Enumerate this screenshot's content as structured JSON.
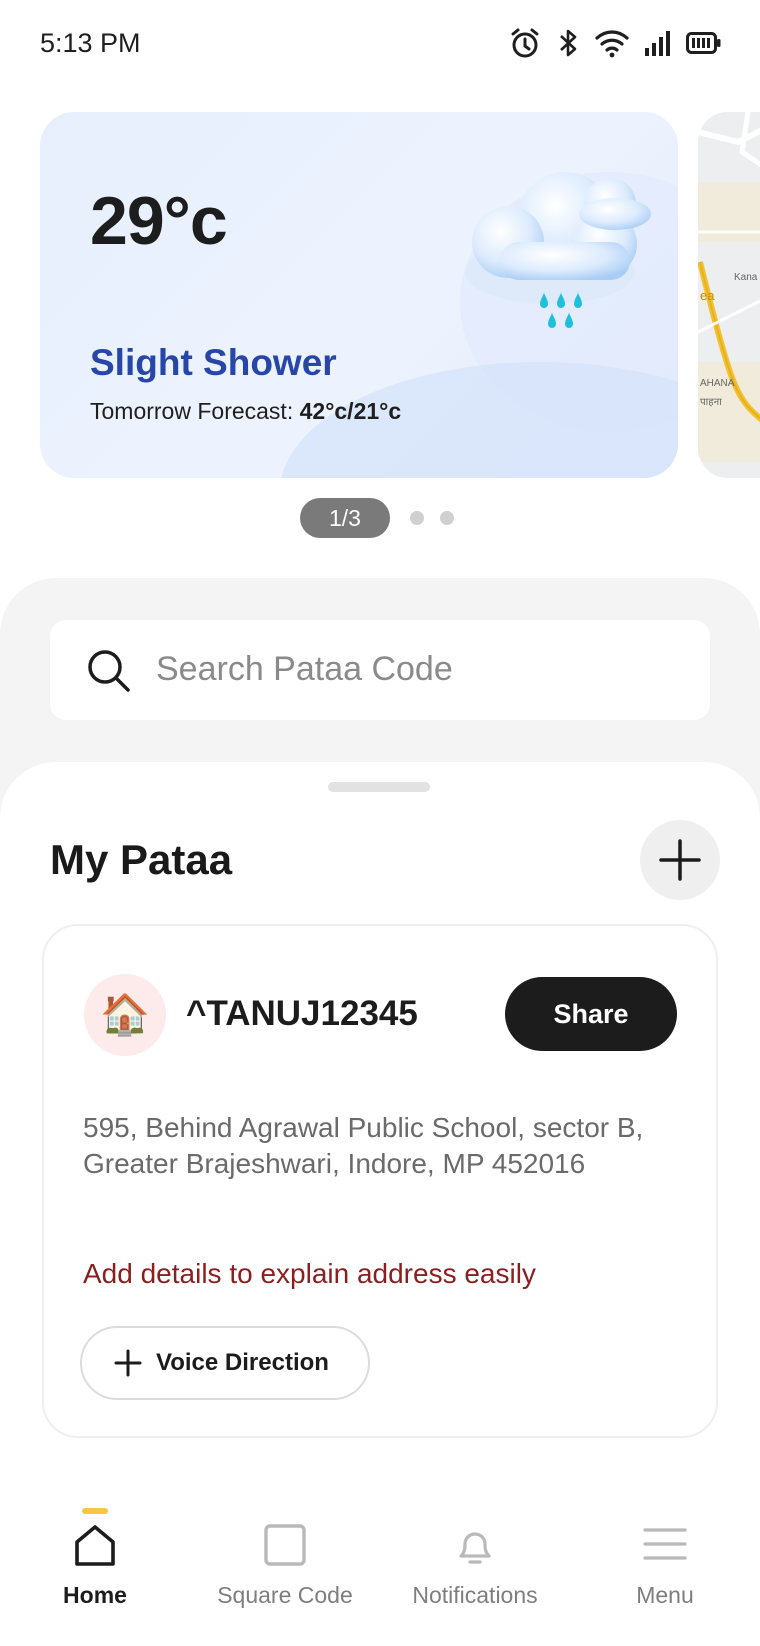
{
  "status_bar": {
    "time": "5:13 PM"
  },
  "weather": {
    "temperature": "29°c",
    "condition": "Slight Shower",
    "forecast_label": "Tomorrow Forecast: ",
    "forecast_value": "42°c/21°c"
  },
  "map_preview": {
    "labels": [
      "Kana",
      "ea",
      "AHANA",
      "पाहना"
    ]
  },
  "pager": {
    "current": "1/3"
  },
  "search": {
    "placeholder": "Search Pataa Code"
  },
  "my_pataa": {
    "title": "My Pataa",
    "entry": {
      "code": "^TANUJ12345",
      "share_label": "Share",
      "address_line1": "595, Behind Agrawal Public School, sector B,",
      "address_line2": "Greater Brajeshwari, Indore, MP 452016",
      "details_prompt": "Add details to explain address easily",
      "voice_direction_label": "Voice Direction",
      "avatar_emoji": "🏠"
    }
  },
  "nav": {
    "items": [
      {
        "label": "Home",
        "icon": "home-icon",
        "active": true
      },
      {
        "label": "Square Code",
        "icon": "square-icon",
        "active": false
      },
      {
        "label": "Notifications",
        "icon": "bell-icon",
        "active": false
      },
      {
        "label": "Menu",
        "icon": "menu-icon",
        "active": false
      }
    ]
  },
  "colors": {
    "accent": "#2746a8",
    "link": "#8b1e1e",
    "indicator": "#f7c744",
    "dark_button": "#1c1c1c"
  }
}
